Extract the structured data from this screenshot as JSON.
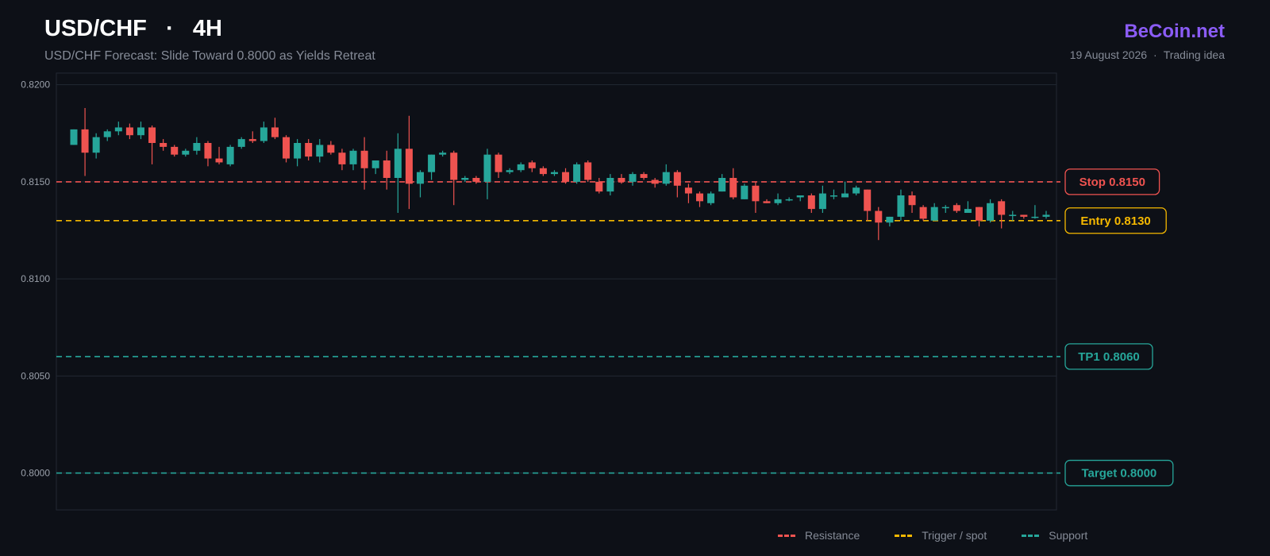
{
  "header": {
    "symbol": "USD/CHF",
    "separator": "·",
    "timeframe": "4H",
    "subtitle": "USD/CHF Forecast: Slide Toward 0.8000 as Yields Retreat",
    "brand": "BeCoin.net",
    "date": "19 August 2026",
    "meta_sep": "·",
    "category": "Trading idea"
  },
  "colors": {
    "background": "#0d1017",
    "up": "#26a69a",
    "down": "#ef5350",
    "trigger": "#f5b800",
    "grid": "#222833",
    "axis_text": "#9aa0aa",
    "brand": "#8b5cf6"
  },
  "legend": [
    {
      "label": "Resistance",
      "color": "#ef5350"
    },
    {
      "label": "Trigger / spot",
      "color": "#f5b800"
    },
    {
      "label": "Support",
      "color": "#26a69a"
    }
  ],
  "chart_data": {
    "type": "candlestick",
    "ylim": [
      0.7981,
      0.8206
    ],
    "yticks": [
      0.82,
      0.815,
      0.81,
      0.805,
      0.8
    ],
    "grid": true,
    "levels": [
      {
        "label": "Stop 0.8150",
        "value": 0.815,
        "kind": "resistance",
        "color": "#ef5350"
      },
      {
        "label": "Entry 0.8130",
        "value": 0.813,
        "kind": "trigger",
        "color": "#f5b800"
      },
      {
        "label": "TP1 0.8060",
        "value": 0.806,
        "kind": "support",
        "color": "#26a69a"
      },
      {
        "label": "Target 0.8000",
        "value": 0.8,
        "kind": "support",
        "color": "#26a69a"
      }
    ],
    "candles": [
      [
        0.8169,
        0.8177,
        0.8169,
        0.8177
      ],
      [
        0.8177,
        0.8188,
        0.8153,
        0.8165
      ],
      [
        0.8165,
        0.8175,
        0.8162,
        0.8173
      ],
      [
        0.8173,
        0.8177,
        0.8171,
        0.8176
      ],
      [
        0.8176,
        0.8181,
        0.8174,
        0.8178
      ],
      [
        0.8178,
        0.818,
        0.8172,
        0.8174
      ],
      [
        0.8174,
        0.8181,
        0.8172,
        0.8178
      ],
      [
        0.8178,
        0.8179,
        0.8159,
        0.817
      ],
      [
        0.817,
        0.8172,
        0.8166,
        0.8168
      ],
      [
        0.8168,
        0.8169,
        0.8163,
        0.8164
      ],
      [
        0.8164,
        0.8167,
        0.8163,
        0.8166
      ],
      [
        0.8166,
        0.8173,
        0.8164,
        0.817
      ],
      [
        0.817,
        0.8171,
        0.8158,
        0.8162
      ],
      [
        0.8162,
        0.8168,
        0.8159,
        0.816
      ],
      [
        0.8159,
        0.8169,
        0.8158,
        0.8168
      ],
      [
        0.8168,
        0.8173,
        0.8167,
        0.8172
      ],
      [
        0.8172,
        0.8176,
        0.817,
        0.8171
      ],
      [
        0.8171,
        0.8181,
        0.817,
        0.8178
      ],
      [
        0.8178,
        0.8183,
        0.8172,
        0.8173
      ],
      [
        0.8173,
        0.8174,
        0.816,
        0.8162
      ],
      [
        0.8162,
        0.8172,
        0.8158,
        0.817
      ],
      [
        0.817,
        0.8172,
        0.8161,
        0.8163
      ],
      [
        0.8163,
        0.8172,
        0.816,
        0.8169
      ],
      [
        0.8169,
        0.8171,
        0.8164,
        0.8165
      ],
      [
        0.8165,
        0.8167,
        0.8156,
        0.8159
      ],
      [
        0.8159,
        0.8167,
        0.8156,
        0.8166
      ],
      [
        0.8166,
        0.8173,
        0.8146,
        0.8157
      ],
      [
        0.8157,
        0.8161,
        0.8154,
        0.8161
      ],
      [
        0.8161,
        0.8166,
        0.8146,
        0.8152
      ],
      [
        0.8152,
        0.8175,
        0.8134,
        0.8167
      ],
      [
        0.8167,
        0.8184,
        0.8136,
        0.8149
      ],
      [
        0.8149,
        0.8156,
        0.8142,
        0.8155
      ],
      [
        0.8155,
        0.8164,
        0.8151,
        0.8164
      ],
      [
        0.8164,
        0.8166,
        0.8163,
        0.8165
      ],
      [
        0.8165,
        0.8166,
        0.8138,
        0.8151
      ],
      [
        0.8151,
        0.8153,
        0.815,
        0.8152
      ],
      [
        0.8152,
        0.8153,
        0.8149,
        0.815
      ],
      [
        0.815,
        0.8167,
        0.8141,
        0.8164
      ],
      [
        0.8164,
        0.8165,
        0.8152,
        0.8155
      ],
      [
        0.8155,
        0.8157,
        0.8154,
        0.8156
      ],
      [
        0.8156,
        0.816,
        0.8155,
        0.8159
      ],
      [
        0.816,
        0.8161,
        0.8155,
        0.8157
      ],
      [
        0.8157,
        0.8158,
        0.8153,
        0.8154
      ],
      [
        0.8154,
        0.8156,
        0.8153,
        0.8155
      ],
      [
        0.8155,
        0.8157,
        0.8149,
        0.815
      ],
      [
        0.815,
        0.816,
        0.8149,
        0.8159
      ],
      [
        0.816,
        0.8161,
        0.815,
        0.8151
      ],
      [
        0.815,
        0.8152,
        0.8144,
        0.8145
      ],
      [
        0.8145,
        0.8154,
        0.8143,
        0.8152
      ],
      [
        0.8152,
        0.8154,
        0.8149,
        0.815
      ],
      [
        0.815,
        0.8155,
        0.8148,
        0.8154
      ],
      [
        0.8154,
        0.8155,
        0.8151,
        0.8152
      ],
      [
        0.8151,
        0.8152,
        0.8147,
        0.8149
      ],
      [
        0.8149,
        0.8159,
        0.8148,
        0.8155
      ],
      [
        0.8155,
        0.8156,
        0.8142,
        0.8148
      ],
      [
        0.8147,
        0.8149,
        0.8139,
        0.8144
      ],
      [
        0.8144,
        0.8145,
        0.8137,
        0.814
      ],
      [
        0.8139,
        0.8145,
        0.8138,
        0.8144
      ],
      [
        0.8145,
        0.8154,
        0.8145,
        0.8152
      ],
      [
        0.8152,
        0.8157,
        0.8141,
        0.8142
      ],
      [
        0.8141,
        0.8149,
        0.8141,
        0.8148
      ],
      [
        0.8148,
        0.815,
        0.8134,
        0.814
      ],
      [
        0.814,
        0.8141,
        0.8139,
        0.8139
      ],
      [
        0.8139,
        0.8144,
        0.8138,
        0.8141
      ],
      [
        0.8141,
        0.8142,
        0.814,
        0.8141
      ],
      [
        0.8142,
        0.8143,
        0.814,
        0.8143
      ],
      [
        0.8143,
        0.8144,
        0.8134,
        0.8136
      ],
      [
        0.8136,
        0.8148,
        0.8134,
        0.8144
      ],
      [
        0.8143,
        0.8146,
        0.8141,
        0.8143
      ],
      [
        0.8142,
        0.815,
        0.8142,
        0.8144
      ],
      [
        0.8144,
        0.8148,
        0.8143,
        0.8147
      ],
      [
        0.8146,
        0.8146,
        0.813,
        0.8135
      ],
      [
        0.8135,
        0.8137,
        0.812,
        0.8129
      ],
      [
        0.8129,
        0.8132,
        0.8127,
        0.8132
      ],
      [
        0.8132,
        0.8146,
        0.813,
        0.8143
      ],
      [
        0.8143,
        0.8145,
        0.8134,
        0.8138
      ],
      [
        0.8137,
        0.8138,
        0.813,
        0.8131
      ],
      [
        0.813,
        0.8139,
        0.813,
        0.8137
      ],
      [
        0.8137,
        0.8138,
        0.8134,
        0.8137
      ],
      [
        0.8138,
        0.8139,
        0.8134,
        0.8135
      ],
      [
        0.8134,
        0.814,
        0.8134,
        0.8136
      ],
      [
        0.8137,
        0.8137,
        0.8127,
        0.813
      ],
      [
        0.813,
        0.8141,
        0.8129,
        0.8139
      ],
      [
        0.814,
        0.8141,
        0.8126,
        0.8133
      ],
      [
        0.8133,
        0.8135,
        0.813,
        0.8133
      ],
      [
        0.8133,
        0.8133,
        0.8131,
        0.8132
      ],
      [
        0.8132,
        0.8138,
        0.8131,
        0.8132
      ],
      [
        0.8132,
        0.8135,
        0.8131,
        0.8133
      ]
    ]
  }
}
